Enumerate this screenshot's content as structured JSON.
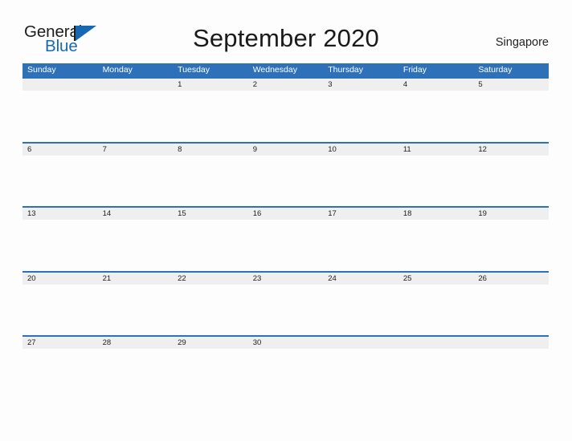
{
  "brand": {
    "name_top": "General",
    "name_bottom": "Blue",
    "triangle_icon": "triangle-right-icon",
    "color_top": "#1d1d1b",
    "color_bottom": "#1668b3"
  },
  "header": {
    "title": "September 2020",
    "locale": "Singapore"
  },
  "colors": {
    "header_blue": "#2e71b8",
    "date_band_gray": "#efefef",
    "page_background": "#fdfdfd",
    "text": "#1c1c1c"
  },
  "calendar": {
    "month": "September",
    "year": "2020",
    "day_headers": [
      "Sunday",
      "Monday",
      "Tuesday",
      "Wednesday",
      "Thursday",
      "Friday",
      "Saturday"
    ],
    "weeks": [
      {
        "days": [
          {
            "date": ""
          },
          {
            "date": ""
          },
          {
            "date": "1"
          },
          {
            "date": "2"
          },
          {
            "date": "3"
          },
          {
            "date": "4"
          },
          {
            "date": "5"
          }
        ]
      },
      {
        "days": [
          {
            "date": "6"
          },
          {
            "date": "7"
          },
          {
            "date": "8"
          },
          {
            "date": "9"
          },
          {
            "date": "10"
          },
          {
            "date": "11"
          },
          {
            "date": "12"
          }
        ]
      },
      {
        "days": [
          {
            "date": "13"
          },
          {
            "date": "14"
          },
          {
            "date": "15"
          },
          {
            "date": "16"
          },
          {
            "date": "17"
          },
          {
            "date": "18"
          },
          {
            "date": "19"
          }
        ]
      },
      {
        "days": [
          {
            "date": "20"
          },
          {
            "date": "21"
          },
          {
            "date": "22"
          },
          {
            "date": "23"
          },
          {
            "date": "24"
          },
          {
            "date": "25"
          },
          {
            "date": "26"
          }
        ]
      },
      {
        "days": [
          {
            "date": "27"
          },
          {
            "date": "28"
          },
          {
            "date": "29"
          },
          {
            "date": "30"
          },
          {
            "date": ""
          },
          {
            "date": ""
          },
          {
            "date": ""
          }
        ]
      }
    ]
  }
}
